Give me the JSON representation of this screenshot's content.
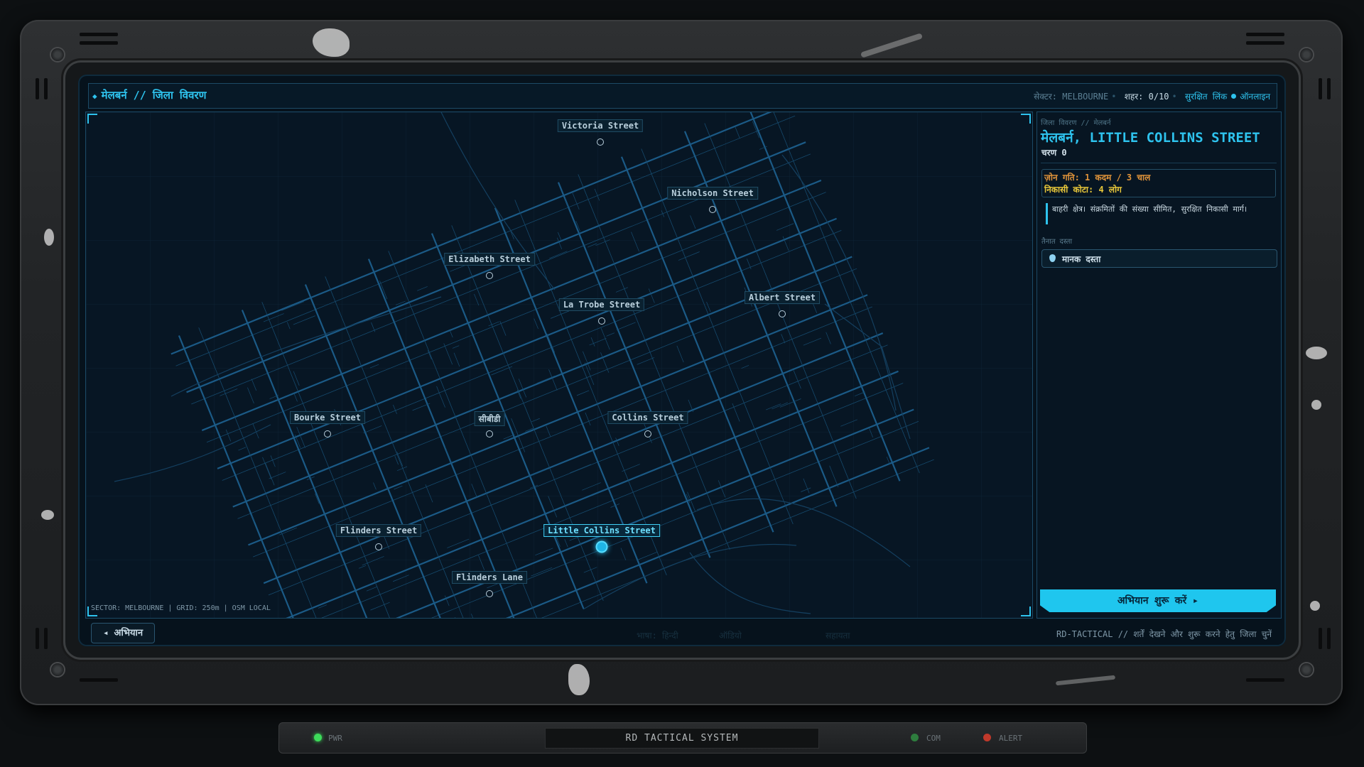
{
  "header": {
    "breadcrumb": "मेलबर्न // जिला विवरण",
    "sector_label": "सेक्टर:",
    "sector_value": "MELBOURNE",
    "city_label": "शहर:",
    "city_value": "0/10",
    "link_label": "सुरक्षित लिंक",
    "online_label": "ऑनलाइन"
  },
  "map": {
    "footer": "SECTOR: MELBOURNE | GRID: 250m | OSM LOCAL",
    "nodes": [
      {
        "name": "Victoria Street",
        "active": false
      },
      {
        "name": "Nicholson Street",
        "active": false
      },
      {
        "name": "Elizabeth Street",
        "active": false
      },
      {
        "name": "La Trobe Street",
        "active": false
      },
      {
        "name": "Albert Street",
        "active": false
      },
      {
        "name": "Bourke Street",
        "active": false
      },
      {
        "name": "सीबीडी",
        "active": false
      },
      {
        "name": "Collins Street",
        "active": false
      },
      {
        "name": "Flinders Street",
        "active": false
      },
      {
        "name": "Little Collins Street",
        "active": true
      },
      {
        "name": "Flinders Lane",
        "active": false
      }
    ]
  },
  "panel": {
    "kicker": "जिला विवरण // मेलबर्न",
    "title": "मेलबर्न, LITTLE COLLINS STREET",
    "stage": "चरण 0",
    "zone_speed": "ज़ोन गति: 1 कदम / 3 चाल",
    "evac_quota": "निकासी कोटा: 4 लोग",
    "description": "बाहरी क्षेत्र। संक्रमितों की संख्या सीमित, सुरक्षित निकासी मार्ग।",
    "squad_label": "तैनात दस्ता",
    "squad_value": "मानक दस्ता",
    "start_button": "अभियान शुरू करें ▸"
  },
  "footer": {
    "back_button": "◂ अभियान",
    "hint": "RD-TACTICAL // शर्तें देखने और शुरू करने हेतु जिला चुनें",
    "ghost_1": "भाषा: हिन्दी",
    "ghost_2": "ऑडियो",
    "ghost_3": "सहायता"
  },
  "console": {
    "pwr": "PWR",
    "system": "RD TACTICAL SYSTEM",
    "com": "COM",
    "alert": "ALERT"
  },
  "colors": {
    "accent": "#2ec3ee",
    "warning": "#e2943a",
    "quota": "#e9c83a",
    "led_on": "#3ddc5a",
    "led_com": "#2e7d3e",
    "led_alert": "#c0392b"
  }
}
